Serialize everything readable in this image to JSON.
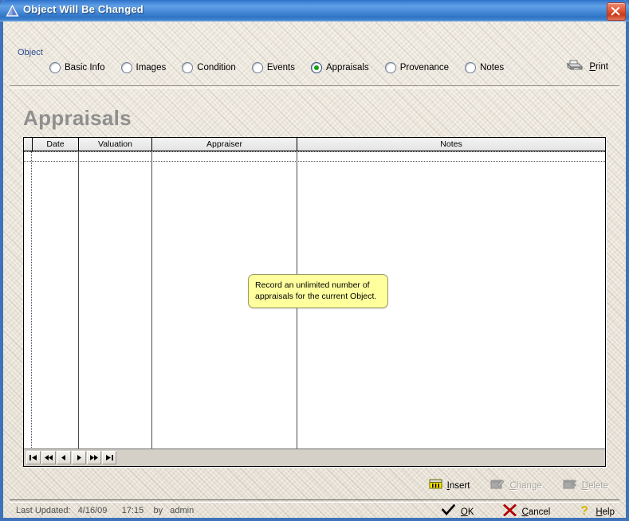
{
  "window": {
    "title": "Object Will Be Changed",
    "icon": "triangle-icon",
    "close_label": "×"
  },
  "nav": {
    "group_label": "Object",
    "tabs": [
      {
        "label": "Basic Info",
        "selected": false
      },
      {
        "label": "Images",
        "selected": false
      },
      {
        "label": "Condition",
        "selected": false
      },
      {
        "label": "Events",
        "selected": false
      },
      {
        "label": "Appraisals",
        "selected": true
      },
      {
        "label": "Provenance",
        "selected": false
      },
      {
        "label": "Notes",
        "selected": false
      }
    ],
    "print": {
      "label": "Print",
      "accel": "P",
      "icon": "printer-icon"
    }
  },
  "main": {
    "heading": "Appraisals",
    "callout": "Record an unlimited number of appraisals for the current Object.",
    "grid": {
      "columns": [
        {
          "label": "Date"
        },
        {
          "label": "Valuation"
        },
        {
          "label": "Appraiser"
        },
        {
          "label": "Notes"
        }
      ],
      "rows": [],
      "nav_buttons": [
        {
          "name": "first-record",
          "glyph": "|◀"
        },
        {
          "name": "prev-page",
          "glyph": "◀◀"
        },
        {
          "name": "prev-record",
          "glyph": "◀"
        },
        {
          "name": "next-record",
          "glyph": "▶"
        },
        {
          "name": "next-page",
          "glyph": "▶▶"
        },
        {
          "name": "last-record",
          "glyph": "▶|"
        }
      ]
    }
  },
  "actions": [
    {
      "label": "Insert",
      "accel": "I",
      "icon": "insert-icon",
      "enabled": true
    },
    {
      "label": "Change",
      "accel": "C",
      "icon": "change-icon",
      "enabled": false
    },
    {
      "label": "Delete",
      "accel": "D",
      "icon": "delete-icon",
      "enabled": false
    }
  ],
  "status": {
    "text": "Last Updated:   4/16/09      17:15    by   admin",
    "label": "Last Updated:",
    "date": "4/16/09",
    "time": "17:15",
    "by_word": "by",
    "user": "admin"
  },
  "dialog_buttons": [
    {
      "label": "OK",
      "accel": "O",
      "icon": "check-icon"
    },
    {
      "label": "Cancel",
      "accel": "C",
      "icon": "x-icon"
    },
    {
      "label": "Help",
      "accel": "H",
      "icon": "question-icon"
    }
  ],
  "colors": {
    "titlebar_blue": "#3f80d0",
    "heading_gray": "#8f8f8f",
    "callout_yellow": "#ffff9e",
    "accent_green": "#18a018",
    "close_red": "#c8391a",
    "group_label_blue": "#2a4b8d"
  }
}
